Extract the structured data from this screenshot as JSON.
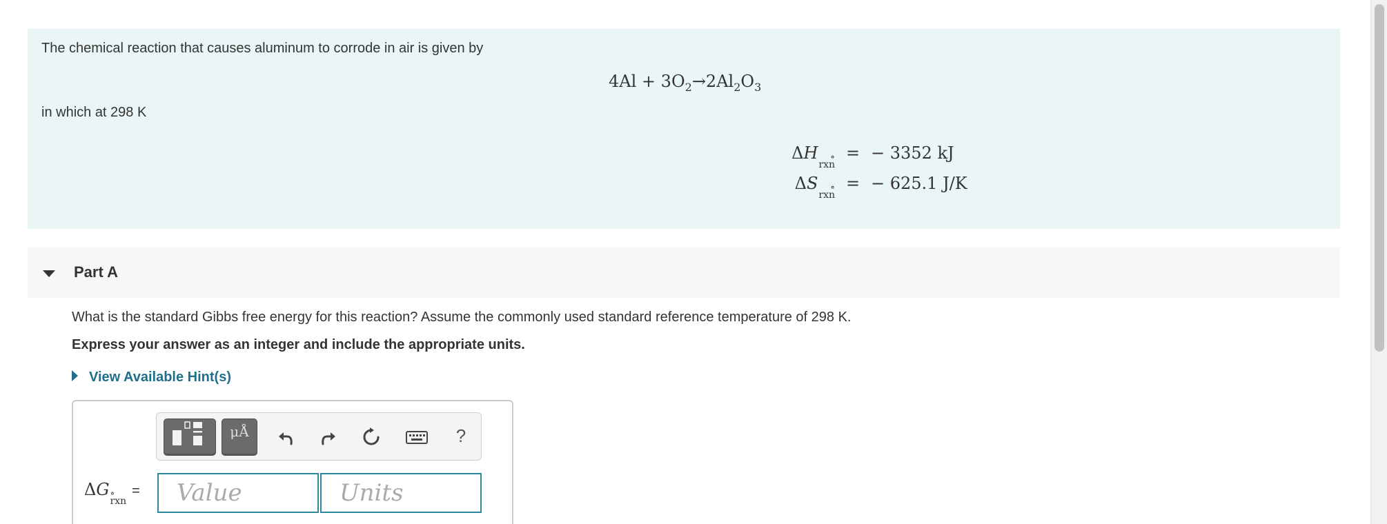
{
  "intro": {
    "line1": "The chemical reaction that causes aluminum to corrode in air is given by",
    "reaction": {
      "lhs1": "4Al",
      "plus": "+",
      "lhs2_coef": "3O",
      "lhs2_sub": "2",
      "arrow": "→",
      "product_coef": "2Al",
      "product_sub1": "2",
      "product_o": "O",
      "product_sub2": "3"
    },
    "line2": "in which at 298 K",
    "thermo": [
      {
        "delta": "Δ",
        "symbol": "H",
        "superscript": "∘",
        "subscript": "rxn",
        "equals": "=",
        "value": "− 3352 kJ"
      },
      {
        "delta": "Δ",
        "symbol": "S",
        "superscript": "∘",
        "subscript": "rxn",
        "equals": "=",
        "value": "− 625.1 J/K"
      }
    ]
  },
  "part": {
    "title": "Part A",
    "question": "What is the standard Gibbs free energy for this reaction? Assume the commonly used standard reference temperature of 298 K.",
    "instruction": "Express your answer as an integer and include the appropriate units.",
    "hints_label": "View Available Hint(s)"
  },
  "answer": {
    "label_delta": "Δ",
    "label_symbol": "G",
    "label_superscript": "∘",
    "label_subscript": "rxn",
    "label_equals": "=",
    "value_placeholder": "Value",
    "units_placeholder": "Units",
    "value": "",
    "units": ""
  },
  "toolbar": {
    "units_button_glyph": "μÅ",
    "help_label": "?",
    "icons": [
      "templates-icon",
      "units-icon",
      "undo-icon",
      "redo-icon",
      "reset-icon",
      "keyboard-icon",
      "help-icon"
    ]
  },
  "colors": {
    "intro_bg": "#eaf6f6",
    "part_header_bg": "#f7f7f7",
    "link": "#1f6f8b",
    "input_border": "#2b8a9e",
    "toolbar_button": "#6b6b6b"
  }
}
